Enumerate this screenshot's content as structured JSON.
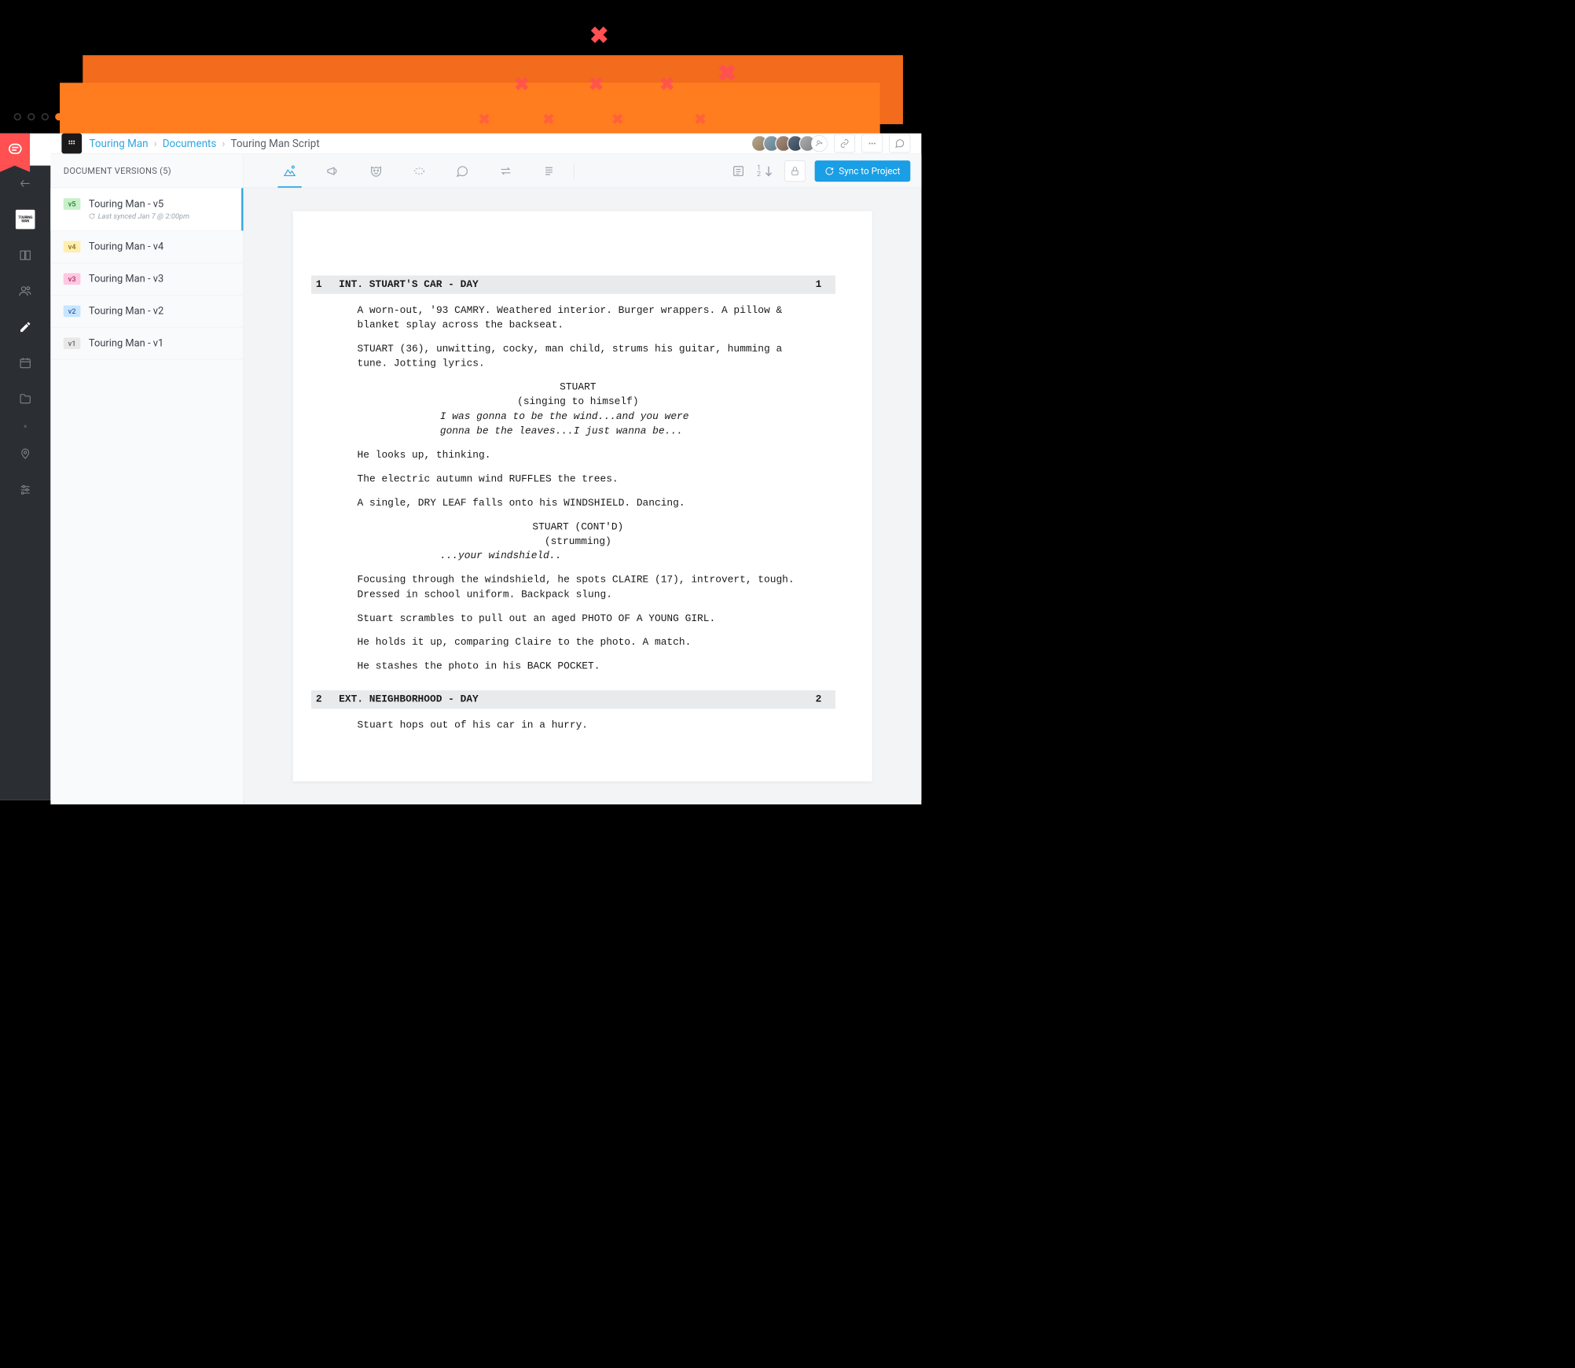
{
  "breadcrumb": {
    "project": "Touring Man",
    "section": "Documents",
    "current": "Touring Man Script"
  },
  "sidebar": {
    "header": "DOCUMENT VERSIONS (5)",
    "versions": [
      {
        "badge": "v5",
        "title": "Touring Man - v5",
        "sync": "Last synced Jan 7 @ 2:00pm",
        "active": true
      },
      {
        "badge": "v4",
        "title": "Touring Man - v4"
      },
      {
        "badge": "v3",
        "title": "Touring Man - v3"
      },
      {
        "badge": "v2",
        "title": "Touring Man - v2"
      },
      {
        "badge": "v1",
        "title": "Touring Man - v1"
      }
    ]
  },
  "toolbar": {
    "sync_label": "Sync to Project"
  },
  "rail": {
    "thumb_label": "TOURING MAN"
  },
  "script": {
    "scenes": [
      {
        "num": "1",
        "heading": "INT. STUART'S CAR - DAY",
        "blocks": [
          {
            "type": "action",
            "text": "A worn-out, '93 CAMRY. Weathered interior. Burger wrappers. A pillow & blanket splay across the backseat."
          },
          {
            "type": "action",
            "text": "STUART (36), unwitting, cocky, man child, strums his guitar, humming a tune. Jotting lyrics."
          },
          {
            "type": "char",
            "text": "STUART"
          },
          {
            "type": "paren",
            "text": "(singing to himself)"
          },
          {
            "type": "dialogue",
            "text": "I was gonna to be the wind...and you were gonna be the leaves...I just wanna be..."
          },
          {
            "type": "action",
            "text": "He looks up, thinking."
          },
          {
            "type": "action",
            "text": "The electric autumn wind RUFFLES the trees."
          },
          {
            "type": "action",
            "text": "A single, DRY LEAF falls onto his WINDSHIELD. Dancing."
          },
          {
            "type": "char",
            "text": "STUART (CONT'D)"
          },
          {
            "type": "paren",
            "text": "(strumming)"
          },
          {
            "type": "dialogue",
            "text": "...your windshield.."
          },
          {
            "type": "action",
            "text": "Focusing through the windshield, he spots CLAIRE (17), introvert, tough. Dressed in school uniform. Backpack slung."
          },
          {
            "type": "action",
            "text": "Stuart scrambles to pull out an aged PHOTO OF A YOUNG GIRL."
          },
          {
            "type": "action",
            "text": "He holds it up, comparing Claire to the photo. A match."
          },
          {
            "type": "action",
            "text": "He stashes the photo in his BACK POCKET."
          }
        ]
      },
      {
        "num": "2",
        "heading": "EXT. NEIGHBORHOOD - DAY",
        "blocks": [
          {
            "type": "action",
            "text": "Stuart hops out of his car in a hurry."
          }
        ]
      }
    ]
  }
}
